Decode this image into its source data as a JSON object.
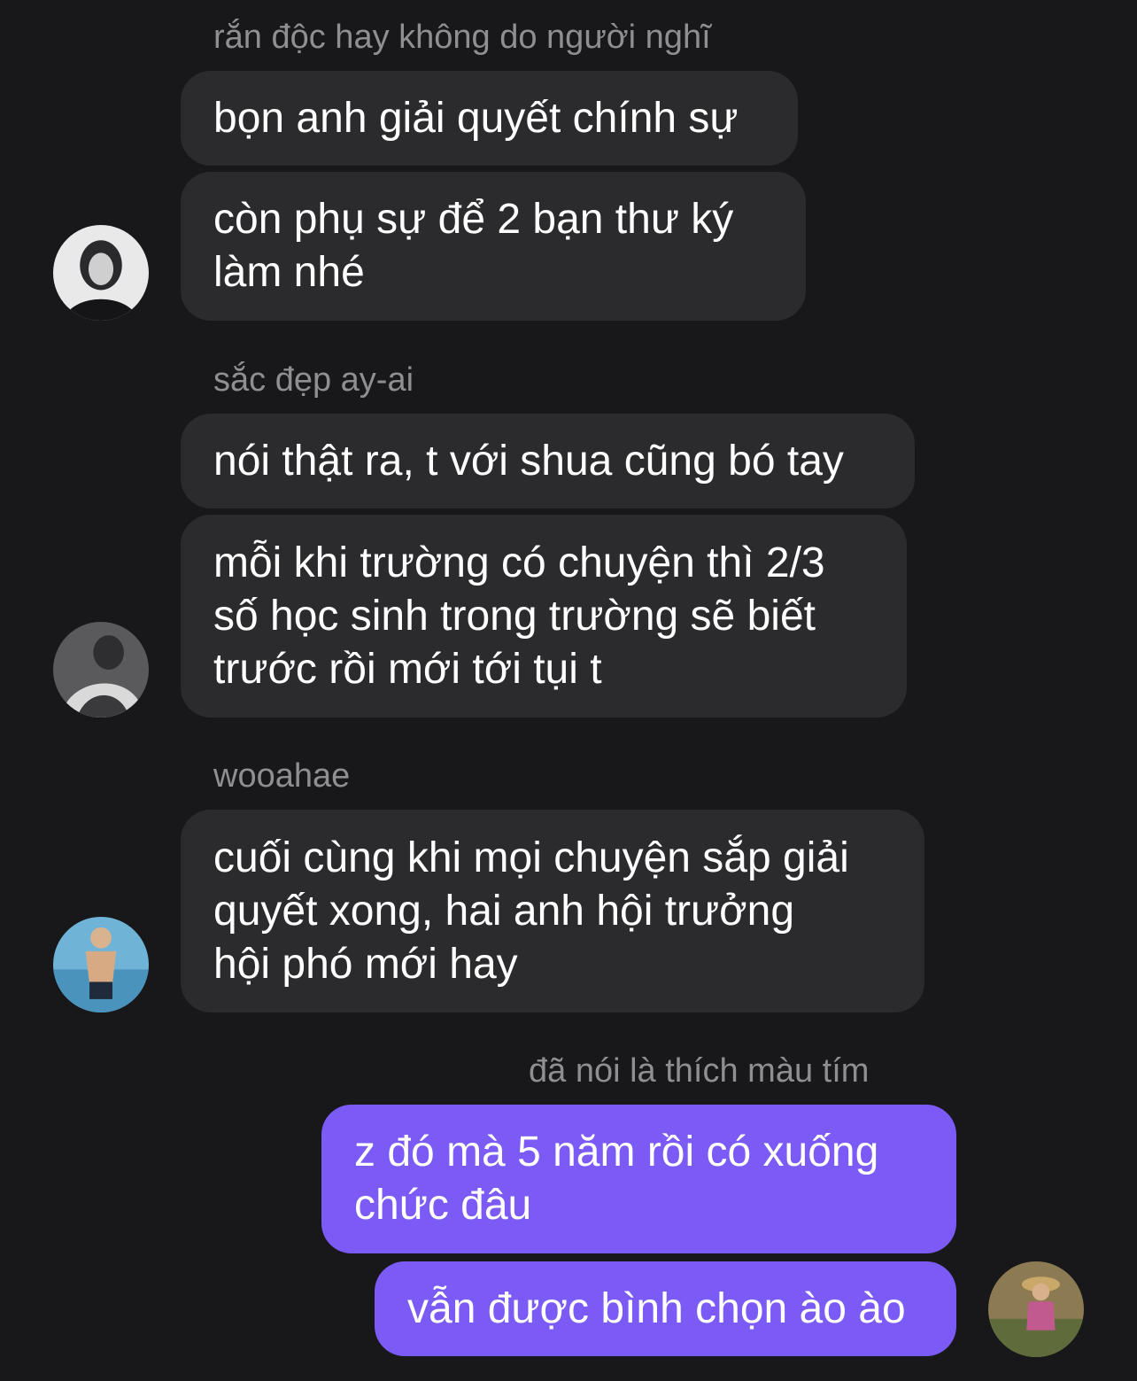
{
  "messages": [
    {
      "sender": "rắn độc hay không do người nghĩ",
      "bubbles": [
        {
          "lines": [
            "bọn anh giải quyết chính sự"
          ]
        },
        {
          "lines": [
            "còn phụ sự để 2 bạn thư ký",
            "làm nhé"
          ]
        }
      ]
    },
    {
      "sender": "sắc đẹp ay-ai",
      "bubbles": [
        {
          "lines": [
            "nói thật ra, t với shua cũng bó tay"
          ]
        },
        {
          "lines": [
            "mỗi khi trường có chuyện thì 2/3",
            "số học sinh trong trường sẽ biết",
            "trước rồi mới tới tụi t"
          ]
        }
      ]
    },
    {
      "sender": "wooahae",
      "bubbles": [
        {
          "lines": [
            "cuối cùng khi mọi chuyện sắp giải",
            "quyết xong, hai anh hội trưởng",
            "hội phó mới hay"
          ]
        }
      ]
    },
    {
      "sender": "đã nói là thích màu tím",
      "bubbles": [
        {
          "lines": [
            "z đó mà 5 năm rồi có xuống",
            "chức đâu"
          ]
        },
        {
          "lines": [
            "vẫn được bình chọn ào ào"
          ]
        }
      ]
    }
  ],
  "colors": {
    "background": "#18181a",
    "incoming_bubble": "#2b2b2d",
    "outgoing_bubble": "#7b5af5",
    "sender_name": "#8e8e93"
  }
}
